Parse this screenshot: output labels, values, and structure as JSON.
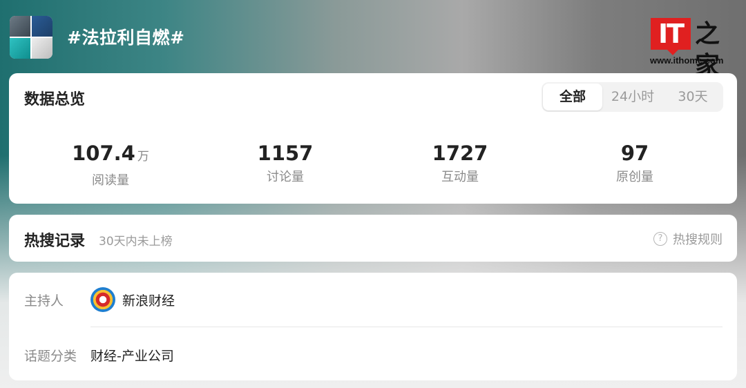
{
  "header": {
    "topic_title": "#法拉利自燃#",
    "logo": {
      "it_text": "IT",
      "zh_text": "之家",
      "url": "www.ithome.com"
    }
  },
  "overview": {
    "title": "数据总览",
    "tabs": [
      {
        "label": "全部",
        "selected": true
      },
      {
        "label": "24小时",
        "selected": false
      },
      {
        "label": "30天",
        "selected": false
      }
    ],
    "stats": [
      {
        "value": "107.4",
        "unit": "万",
        "label": "阅读量"
      },
      {
        "value": "1157",
        "unit": "",
        "label": "讨论量"
      },
      {
        "value": "1727",
        "unit": "",
        "label": "互动量"
      },
      {
        "value": "97",
        "unit": "",
        "label": "原创量"
      }
    ]
  },
  "hot_search": {
    "title": "热搜记录",
    "subtitle": "30天内未上榜",
    "rules_icon": "question-circle-icon",
    "rules_label": "热搜规则"
  },
  "info": {
    "host_label": "主持人",
    "host_name": "新浪财经",
    "category_label": "话题分类",
    "category_value": "财经-产业公司"
  },
  "colors": {
    "accent_red": "#e02020",
    "text_primary": "#222222",
    "text_secondary": "#8a8a8a"
  }
}
